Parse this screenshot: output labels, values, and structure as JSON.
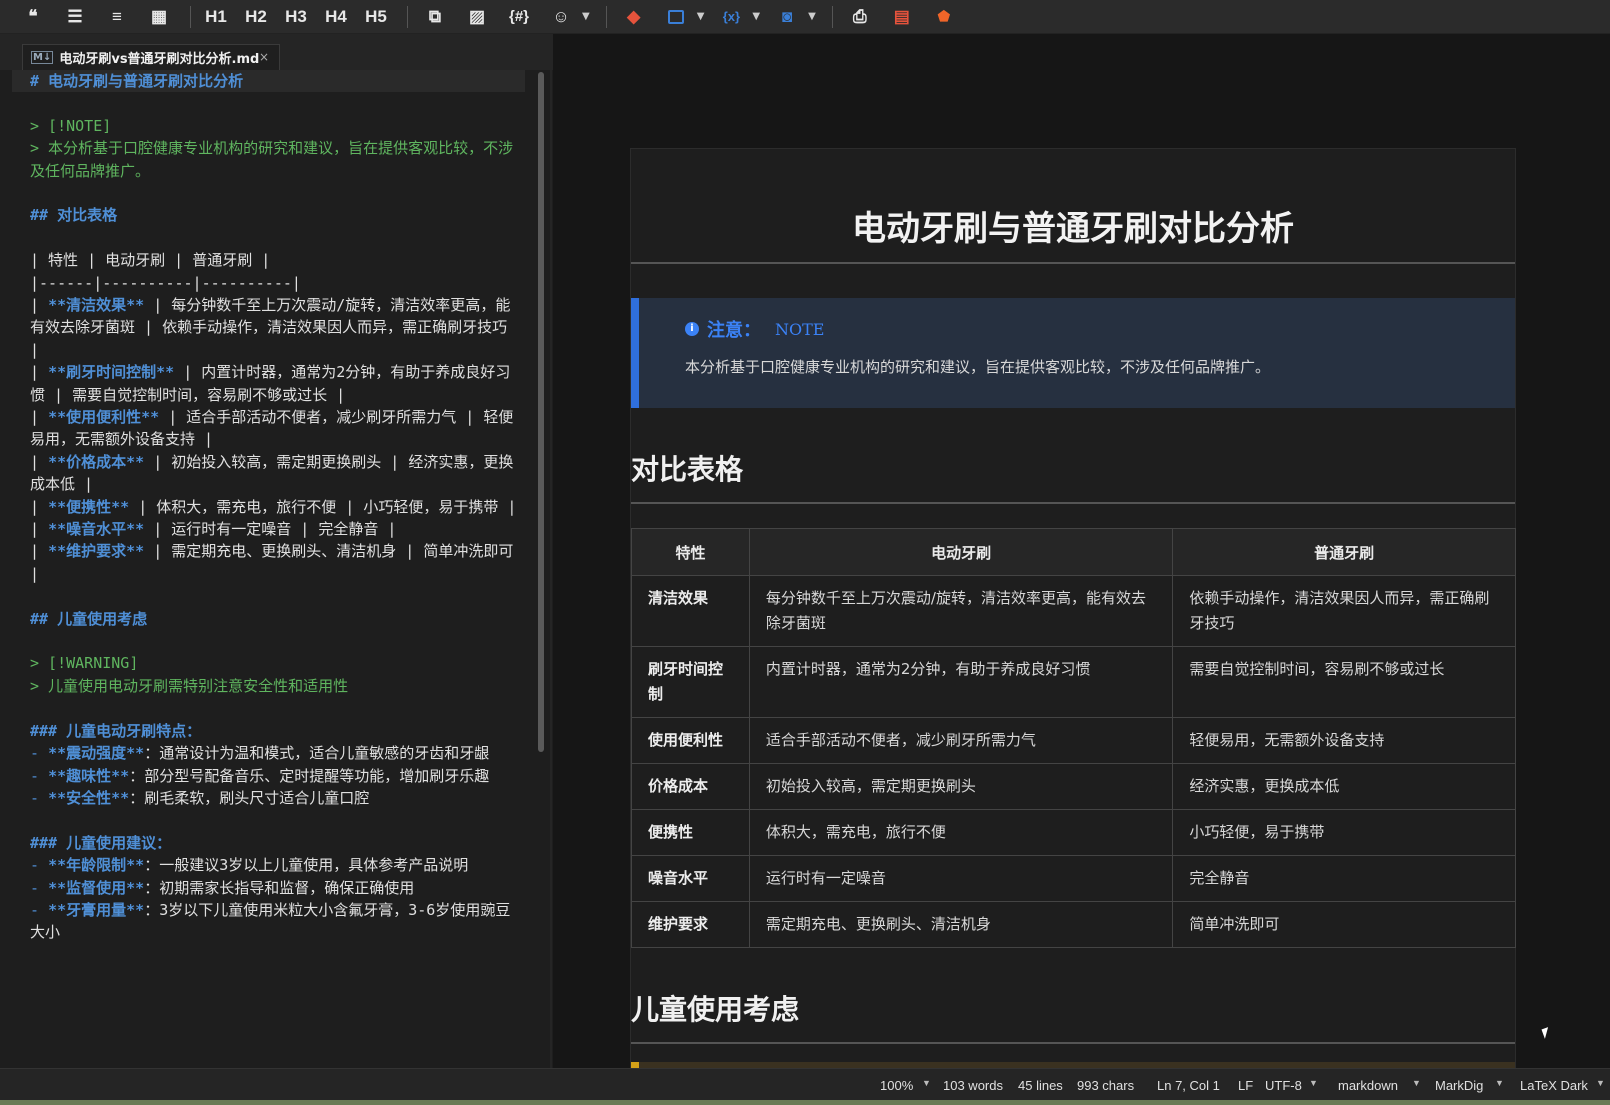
{
  "toolbar": {
    "h1": "H1",
    "h2": "H2",
    "h3": "H3",
    "h4": "H4",
    "h5": "H5",
    "code_label": "{#}"
  },
  "tab": {
    "filename": "电动牙刷vs普通牙刷对比分析.md",
    "close": "×"
  },
  "editor_lines": [
    {
      "t": "# 电动牙刷与普通牙刷对比分析",
      "k": "head",
      "curr": true
    },
    {
      "t": "",
      "k": ""
    },
    {
      "t": "> [!NOTE]",
      "k": "quote"
    },
    {
      "t": "> 本分析基于口腔健康专业机构的研究和建议，旨在提供客观比较，不涉及任何品牌推广。",
      "k": "quote"
    },
    {
      "t": "",
      "k": ""
    },
    {
      "t": "## 对比表格",
      "k": "head"
    },
    {
      "t": "",
      "k": ""
    },
    {
      "t": "| 特性 | 电动牙刷 | 普通牙刷 |",
      "k": ""
    },
    {
      "t": "|------|----------|----------|",
      "k": ""
    },
    {
      "t": "| **清洁效果** | 每分钟数千至上万次震动/旋转，清洁效率更高，能有效去除牙菌斑 | 依赖手动操作，清洁效果因人而异，需正确刷牙技巧 |",
      "k": "row",
      "b": "**清洁效果**"
    },
    {
      "t": "| **刷牙时间控制** | 内置计时器，通常为2分钟，有助于养成良好习惯 | 需要自觉控制时间，容易刷不够或过长 |",
      "k": "row",
      "b": "**刷牙时间控制**"
    },
    {
      "t": "| **使用便利性** | 适合手部活动不便者，减少刷牙所需力气 | 轻便易用，无需额外设备支持 |",
      "k": "row",
      "b": "**使用便利性**"
    },
    {
      "t": "| **价格成本** | 初始投入较高，需定期更换刷头 | 经济实惠，更换成本低 |",
      "k": "row",
      "b": "**价格成本**"
    },
    {
      "t": "| **便携性** | 体积大，需充电，旅行不便 | 小巧轻便，易于携带 |",
      "k": "row",
      "b": "**便携性**"
    },
    {
      "t": "| **噪音水平** | 运行时有一定噪音 | 完全静音 |",
      "k": "row",
      "b": "**噪音水平**"
    },
    {
      "t": "| **维护要求** | 需定期充电、更换刷头、清洁机身 | 简单冲洗即可 |",
      "k": "row",
      "b": "**维护要求**"
    },
    {
      "t": "",
      "k": ""
    },
    {
      "t": "## 儿童使用考虑",
      "k": "head"
    },
    {
      "t": "",
      "k": ""
    },
    {
      "t": "> [!WARNING]",
      "k": "quote"
    },
    {
      "t": "> 儿童使用电动牙刷需特别注意安全性和适用性",
      "k": "quote"
    },
    {
      "t": "",
      "k": ""
    },
    {
      "t": "### 儿童电动牙刷特点：",
      "k": "head"
    },
    {
      "t": "- **震动强度**：通常设计为温和模式，适合儿童敏感的牙齿和牙龈",
      "k": "list",
      "b": "**震动强度**"
    },
    {
      "t": "- **趣味性**：部分型号配备音乐、定时提醒等功能，增加刷牙乐趣",
      "k": "list",
      "b": "**趣味性**"
    },
    {
      "t": "- **安全性**：刷毛柔软，刷头尺寸适合儿童口腔",
      "k": "list",
      "b": "**安全性**"
    },
    {
      "t": "",
      "k": ""
    },
    {
      "t": "### 儿童使用建议：",
      "k": "head"
    },
    {
      "t": "- **年龄限制**：一般建议3岁以上儿童使用，具体参考产品说明",
      "k": "list",
      "b": "**年龄限制**"
    },
    {
      "t": "- **监督使用**：初期需家长指导和监督，确保正确使用",
      "k": "list",
      "b": "**监督使用**"
    },
    {
      "t": "- **牙膏用量**：3岁以下儿童使用米粒大小含氟牙膏，3-6岁使用豌豆大小",
      "k": "list",
      "b": "**牙膏用量**"
    }
  ],
  "preview": {
    "title": "电动牙刷与普通牙刷对比分析",
    "note_label": "注意：",
    "note_tag": "NOTE",
    "note_body": "本分析基于口腔健康专业机构的研究和建议，旨在提供客观比较，不涉及任何品牌推广。",
    "h2_compare": "对比表格",
    "h2_kids": "儿童使用考虑",
    "table": {
      "headers": [
        "特性",
        "电动牙刷",
        "普通牙刷"
      ],
      "rows": [
        [
          "清洁效果",
          "每分钟数千至上万次震动/旋转，清洁效率更高，能有效去除牙菌斑",
          "依赖手动操作，清洁效果因人而异，需正确刷牙技巧"
        ],
        [
          "刷牙时间控制",
          "内置计时器，通常为2分钟，有助于养成良好习惯",
          "需要自觉控制时间，容易刷不够或过长"
        ],
        [
          "使用便利性",
          "适合手部活动不便者，减少刷牙所需力气",
          "轻便易用，无需额外设备支持"
        ],
        [
          "价格成本",
          "初始投入较高，需定期更换刷头",
          "经济实惠，更换成本低"
        ],
        [
          "便携性",
          "体积大，需充电，旅行不便",
          "小巧轻便，易于携带"
        ],
        [
          "噪音水平",
          "运行时有一定噪音",
          "完全静音"
        ],
        [
          "维护要求",
          "需定期充电、更换刷头、清洁机身",
          "简单冲洗即可"
        ]
      ]
    }
  },
  "status": {
    "zoom": "100%",
    "words": "103 words",
    "lines": "45 lines",
    "chars": "993 chars",
    "position": "Ln 7, Col 1",
    "line_ending": "LF",
    "encoding": "UTF-8",
    "language": "markdown",
    "engine": "MarkDig",
    "theme": "LaTeX Dark"
  },
  "colors": {
    "accent_blue": "#3b82f6",
    "quote_green": "#5fb55f",
    "warning_yellow": "#d4a017",
    "pdf_red": "#e5533c",
    "html_orange": "#f06529"
  }
}
